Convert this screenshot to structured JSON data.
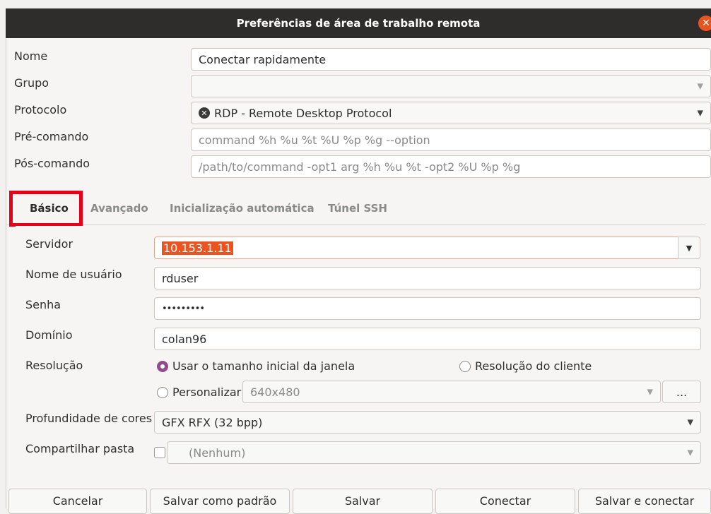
{
  "window": {
    "title": "Preferências de área de trabalho remota",
    "close_glyph": "✕",
    "accent": "#e95420"
  },
  "profile": {
    "name_label": "Nome",
    "name_value": "Conectar rapidamente",
    "group_label": "Grupo",
    "group_value": "",
    "protocol_label": "Protocolo",
    "protocol_value": "RDP - Remote Desktop Protocol",
    "precommand_label": "Pré-comando",
    "precommand_placeholder": "command %h %u %t %U %p %g --option",
    "postcommand_label": "Pós-comando",
    "postcommand_placeholder": "/path/to/command -opt1 arg %h %u %t -opt2 %U %p %g"
  },
  "tabs": [
    {
      "label": "Básico",
      "active": true
    },
    {
      "label": "Avançado",
      "active": false
    },
    {
      "label": "Inicialização automática",
      "active": false
    },
    {
      "label": "Túnel SSH",
      "active": false
    }
  ],
  "basic": {
    "server_label": "Servidor",
    "server_value": "10.153.1.11",
    "user_label": "Nome de usuário",
    "user_value": "rduser",
    "password_label": "Senha",
    "password_value": "•••••••••",
    "domain_label": "Domínio",
    "domain_value": "colan96",
    "resolution_label": "Resolução",
    "res_initial": "Usar o tamanho inicial da janela",
    "res_client": "Resolução do cliente",
    "res_custom": "Personalizar",
    "res_custom_value": "640x480",
    "res_more": "...",
    "color_label": "Profundidade de cores",
    "color_value": "GFX RFX (32 bpp)",
    "share_label": "Compartilhar pasta",
    "share_value": "(Nenhum)"
  },
  "buttons": {
    "cancel": "Cancelar",
    "save_default": "Salvar como padrão",
    "save": "Salvar",
    "connect": "Conectar",
    "save_connect": "Salvar e conectar"
  },
  "icons": {
    "dropdown": "chevron-down-icon",
    "protocol": "rdp-protocol-icon"
  },
  "colors": {
    "highlight_box": "#e8001b",
    "radio_selected": "#924d8b"
  }
}
